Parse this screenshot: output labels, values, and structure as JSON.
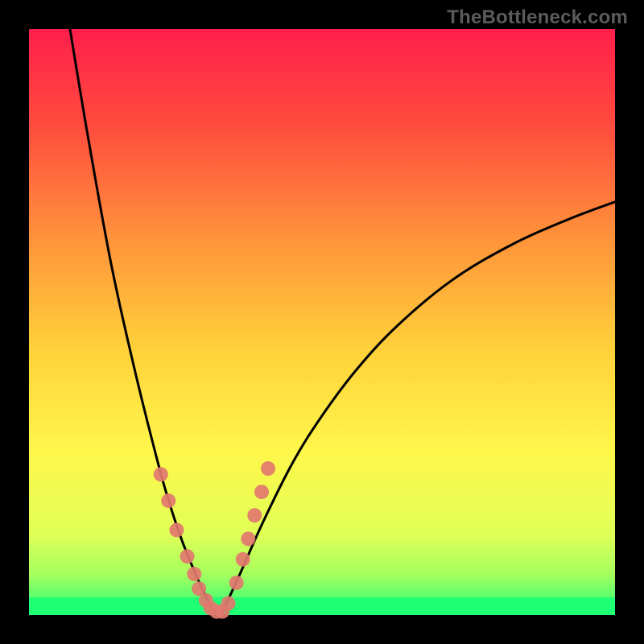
{
  "watermark": {
    "text": "TheBottleneck.com"
  },
  "chart_data": {
    "type": "line",
    "title": "",
    "xlabel": "",
    "ylabel": "",
    "xlim": [
      0,
      100
    ],
    "ylim": [
      0,
      100
    ],
    "series": [
      {
        "name": "left-branch",
        "x": [
          7.0,
          10.0,
          14.0,
          18.0,
          22.0,
          24.0,
          26.0,
          28.0,
          30.0,
          31.5
        ],
        "y": [
          100.0,
          82.0,
          60.0,
          42.0,
          26.0,
          19.0,
          13.0,
          8.0,
          3.5,
          0.5
        ]
      },
      {
        "name": "right-branch",
        "x": [
          33.0,
          36.0,
          40.0,
          45.0,
          50.0,
          56.0,
          63.0,
          72.0,
          82.0,
          92.0,
          100.0
        ],
        "y": [
          0.5,
          7.0,
          16.0,
          26.0,
          34.0,
          42.0,
          49.5,
          57.0,
          63.0,
          67.5,
          70.5
        ]
      }
    ],
    "highlight_dots": {
      "comment": "salmon dots along the curve around the minimum",
      "x": [
        22.5,
        23.8,
        25.2,
        27.0,
        28.2,
        29.0,
        30.2,
        31.0,
        32.0,
        33.0,
        34.0,
        35.4,
        36.5,
        37.4,
        38.5,
        39.7,
        40.8
      ],
      "y": [
        24.0,
        19.5,
        14.5,
        10.0,
        7.0,
        4.5,
        2.5,
        1.2,
        0.6,
        0.6,
        2.0,
        5.5,
        9.5,
        13.0,
        17.0,
        21.0,
        25.0
      ]
    },
    "green_band": {
      "comment": "thin bright-green band at the very bottom of the plot",
      "y_from": 0,
      "y_to": 3
    },
    "curve_color": "#000000",
    "curve_stroke_width": 3,
    "dot_color": "#e2786e",
    "dot_radius": 9
  },
  "colors": {
    "gradient_stops": [
      {
        "pct": 0,
        "hex": "#ff1f4b"
      },
      {
        "pct": 16,
        "hex": "#ff4a3e"
      },
      {
        "pct": 36,
        "hex": "#ff943a"
      },
      {
        "pct": 55,
        "hex": "#ffd23a"
      },
      {
        "pct": 72,
        "hex": "#fff64a"
      },
      {
        "pct": 86,
        "hex": "#e1ff57"
      },
      {
        "pct": 93,
        "hex": "#a6ff5e"
      },
      {
        "pct": 100,
        "hex": "#22ff7a"
      }
    ]
  }
}
